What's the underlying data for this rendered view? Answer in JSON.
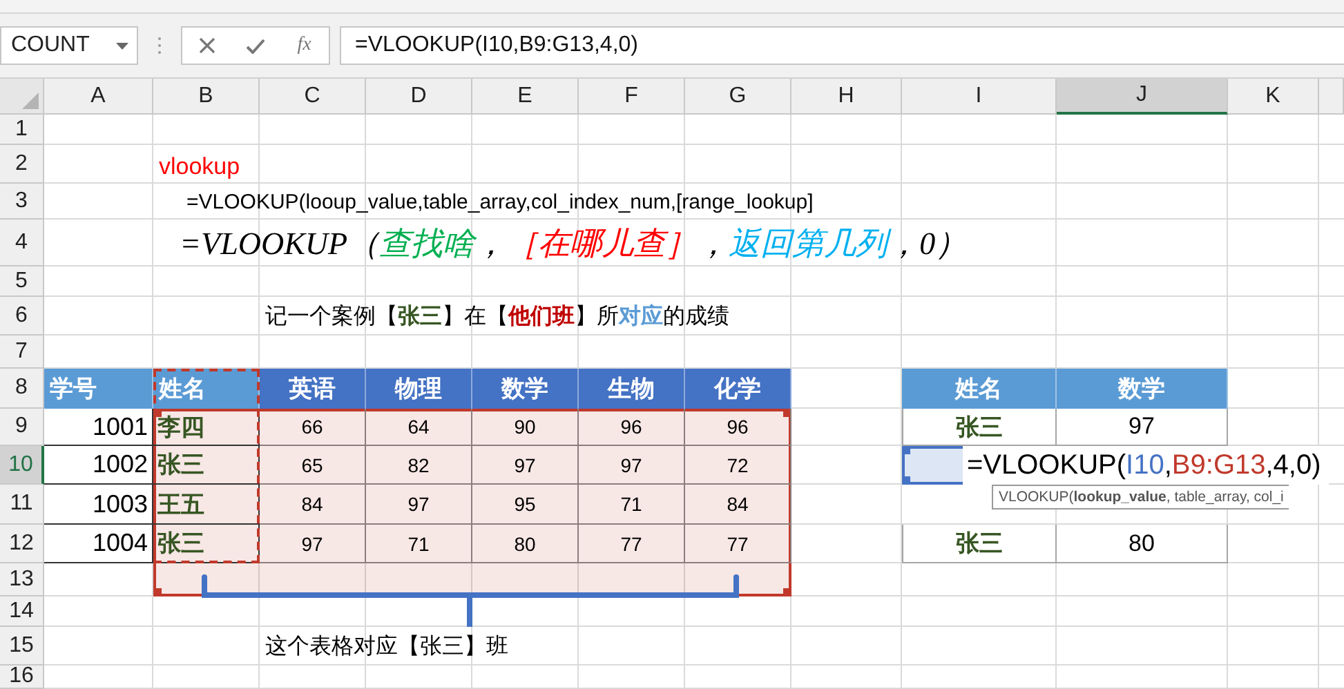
{
  "name_box": "COUNT",
  "function_button": "fx",
  "formula": "=VLOOKUP(I10,B9:G13,4,0)",
  "sheet": {
    "columns": [
      {
        "label": "A",
        "selected": false
      },
      {
        "label": "B",
        "selected": false
      },
      {
        "label": "C",
        "selected": false
      },
      {
        "label": "D",
        "selected": false
      },
      {
        "label": "E",
        "selected": false
      },
      {
        "label": "F",
        "selected": false
      },
      {
        "label": "G",
        "selected": false
      },
      {
        "label": "H",
        "selected": false
      },
      {
        "label": "I",
        "selected": false
      },
      {
        "label": "J",
        "selected": true
      },
      {
        "label": "K",
        "selected": false
      }
    ],
    "rows": [
      {
        "label": "1",
        "selected": false
      },
      {
        "label": "2",
        "selected": false,
        "cells": [
          null,
          {
            "kind": "title",
            "text": "vlookup"
          }
        ]
      },
      {
        "label": "3",
        "selected": false,
        "cells": [
          null,
          {
            "kind": "syntax",
            "text": "=VLOOKUP(looup_value,table_array,col_index_num,[range_lookup]"
          }
        ]
      },
      {
        "label": "4",
        "selected": false,
        "cells": [
          null,
          {
            "kind": "formula-note",
            "segments": [
              {
                "text": "=VLOOKUP（",
                "color": "#000000"
              },
              {
                "text": "查找啥",
                "color": "#00b050"
              },
              {
                "text": "，",
                "color": "#000000"
              },
              {
                "text": "［在哪儿查］",
                "color": "#ff0000"
              },
              {
                "text": "，",
                "color": "#000000"
              },
              {
                "text": "返回第几列",
                "color": "#00b0f0"
              },
              {
                "text": "，0）",
                "color": "#000000"
              }
            ]
          }
        ]
      },
      {
        "label": "5",
        "selected": false
      },
      {
        "label": "6",
        "selected": false,
        "cells": [
          null,
          null,
          {
            "kind": "sentence",
            "segments": [
              {
                "text": "记一个案例【",
                "color": "#000000",
                "bold": false
              },
              {
                "text": "张三",
                "color": "#375623",
                "bold": true
              },
              {
                "text": "】在【",
                "color": "#000000",
                "bold": false
              },
              {
                "text": "他们班",
                "color": "#c00000",
                "bold": true
              },
              {
                "text": "】所",
                "color": "#000000",
                "bold": false
              },
              {
                "text": "对应",
                "color": "#5b9bd5",
                "bold": true
              },
              {
                "text": "的成绩",
                "color": "#000000",
                "bold": false
              }
            ]
          }
        ]
      },
      {
        "label": "7",
        "selected": false
      },
      {
        "label": "8",
        "selected": false,
        "cells": [
          {
            "kind": "head-light",
            "text": "学号"
          },
          {
            "kind": "head-light",
            "text": "姓名"
          },
          {
            "kind": "head-dark",
            "text": "英语"
          },
          {
            "kind": "head-dark",
            "text": "物理"
          },
          {
            "kind": "head-dark",
            "text": "数学"
          },
          {
            "kind": "head-dark",
            "text": "生物"
          },
          {
            "kind": "head-dark",
            "text": "化学"
          },
          null,
          {
            "kind": "lookup-head",
            "text": "姓名"
          },
          {
            "kind": "lookup-head",
            "text": "数学"
          }
        ]
      },
      {
        "label": "9",
        "selected": false,
        "cells": [
          {
            "kind": "id",
            "text": "1001"
          },
          {
            "kind": "name",
            "text": "李四"
          },
          {
            "kind": "score",
            "text": "66"
          },
          {
            "kind": "score",
            "text": "64"
          },
          {
            "kind": "score",
            "text": "90"
          },
          {
            "kind": "score",
            "text": "96"
          },
          {
            "kind": "score",
            "text": "96"
          },
          null,
          {
            "kind": "lookup-name",
            "text": "张三"
          },
          {
            "kind": "lookup-score",
            "text": "97"
          }
        ]
      },
      {
        "label": "10",
        "selected": true,
        "cells": [
          {
            "kind": "id",
            "text": "1002"
          },
          {
            "kind": "name",
            "text": "张三"
          },
          {
            "kind": "score",
            "text": "65"
          },
          {
            "kind": "score",
            "text": "82"
          },
          {
            "kind": "score",
            "text": "97"
          },
          {
            "kind": "score",
            "text": "97"
          },
          {
            "kind": "score",
            "text": "72"
          }
        ]
      },
      {
        "label": "11",
        "selected": false,
        "cells": [
          {
            "kind": "id",
            "text": "1003"
          },
          {
            "kind": "name",
            "text": "王五"
          },
          {
            "kind": "score",
            "text": "84"
          },
          {
            "kind": "score",
            "text": "97"
          },
          {
            "kind": "score",
            "text": "95"
          },
          {
            "kind": "score",
            "text": "71"
          },
          {
            "kind": "score",
            "text": "84"
          }
        ]
      },
      {
        "label": "12",
        "selected": false,
        "cells": [
          {
            "kind": "id",
            "text": "1004"
          },
          {
            "kind": "name",
            "text": "张三"
          },
          {
            "kind": "score",
            "text": "97"
          },
          {
            "kind": "score",
            "text": "71"
          },
          {
            "kind": "score",
            "text": "80"
          },
          {
            "kind": "score",
            "text": "77"
          },
          {
            "kind": "score",
            "text": "77"
          },
          null,
          {
            "kind": "lookup-name",
            "text": "张三"
          },
          {
            "kind": "lookup-score",
            "text": "80"
          }
        ]
      },
      {
        "label": "13",
        "selected": false
      },
      {
        "label": "14",
        "selected": false
      },
      {
        "label": "15",
        "selected": false,
        "cells": [
          null,
          null,
          {
            "kind": "caption",
            "text": "这个表格对应【张三】班"
          }
        ]
      },
      {
        "label": "16",
        "selected": false
      }
    ]
  },
  "copy_marquee": true,
  "references": [
    {
      "color": "#4472c4"
    },
    {
      "color": "#c0392b"
    }
  ],
  "cell_editor": {
    "segments": [
      {
        "text": "=VLOOKUP(",
        "color": "#000000"
      },
      {
        "text": "I10",
        "color": "#4472c4"
      },
      {
        "text": ",",
        "color": "#000000"
      },
      {
        "text": "B9:G13",
        "color": "#c0392b"
      },
      {
        "text": ",4,0)",
        "color": "#000000"
      }
    ]
  },
  "tooltip": "VLOOKUP(**lookup_value**, table_array, col_i"
}
